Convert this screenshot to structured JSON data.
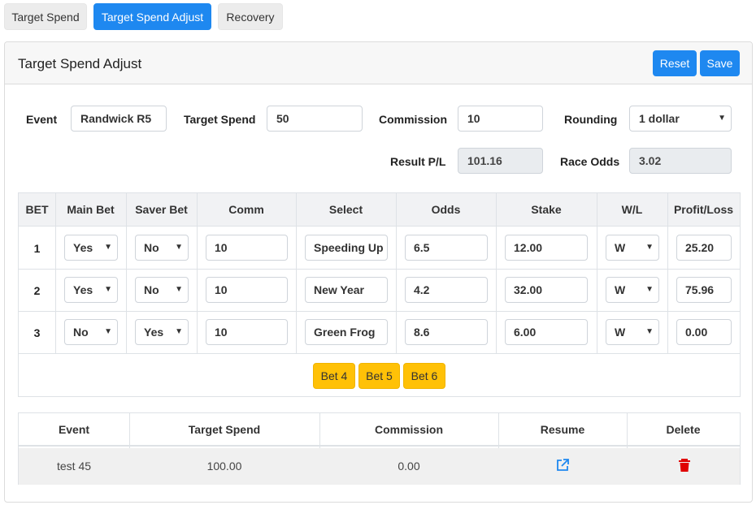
{
  "tabs": [
    {
      "label": "Target Spend",
      "active": false
    },
    {
      "label": "Target Spend Adjust",
      "active": true
    },
    {
      "label": "Recovery",
      "active": false
    }
  ],
  "card": {
    "title": "Target Spend Adjust",
    "reset_label": "Reset",
    "save_label": "Save"
  },
  "form": {
    "event_label": "Event",
    "event_value": "Randwick R5",
    "target_spend_label": "Target Spend",
    "target_spend_value": "50",
    "commission_label": "Commission",
    "commission_value": "10",
    "rounding_label": "Rounding",
    "rounding_value": "1 dollar",
    "result_label": "Result P/L",
    "result_value": "101.16",
    "race_odds_label": "Race Odds",
    "race_odds_value": "3.02"
  },
  "bets_table": {
    "headers": [
      "BET",
      "Main Bet",
      "Saver Bet",
      "Comm",
      "Select",
      "Odds",
      "Stake",
      "W/L",
      "Profit/Loss"
    ],
    "rows": [
      {
        "bet": "1",
        "main": "Yes",
        "saver": "No",
        "comm": "10",
        "select": "Speeding Up",
        "odds": "6.5",
        "stake": "12.00",
        "wl": "W",
        "pl": "25.20"
      },
      {
        "bet": "2",
        "main": "Yes",
        "saver": "No",
        "comm": "10",
        "select": "New Year",
        "odds": "4.2",
        "stake": "32.00",
        "wl": "W",
        "pl": "75.96"
      },
      {
        "bet": "3",
        "main": "No",
        "saver": "Yes",
        "comm": "10",
        "select": "Green Frog",
        "odds": "8.6",
        "stake": "6.00",
        "wl": "W",
        "pl": "0.00"
      }
    ],
    "add_buttons": [
      "Bet 4",
      "Bet 5",
      "Bet 6"
    ]
  },
  "saved_table": {
    "headers": [
      "Event",
      "Target Spend",
      "Commission",
      "Resume",
      "Delete"
    ],
    "rows": [
      {
        "event": "test 45",
        "target_spend": "100.00",
        "commission": "0.00"
      }
    ]
  },
  "colors": {
    "primary": "#1e88f0",
    "warning": "#ffc107",
    "danger": "#e00000"
  },
  "icons": {
    "resume": "external-link-icon",
    "delete": "trash-icon"
  }
}
